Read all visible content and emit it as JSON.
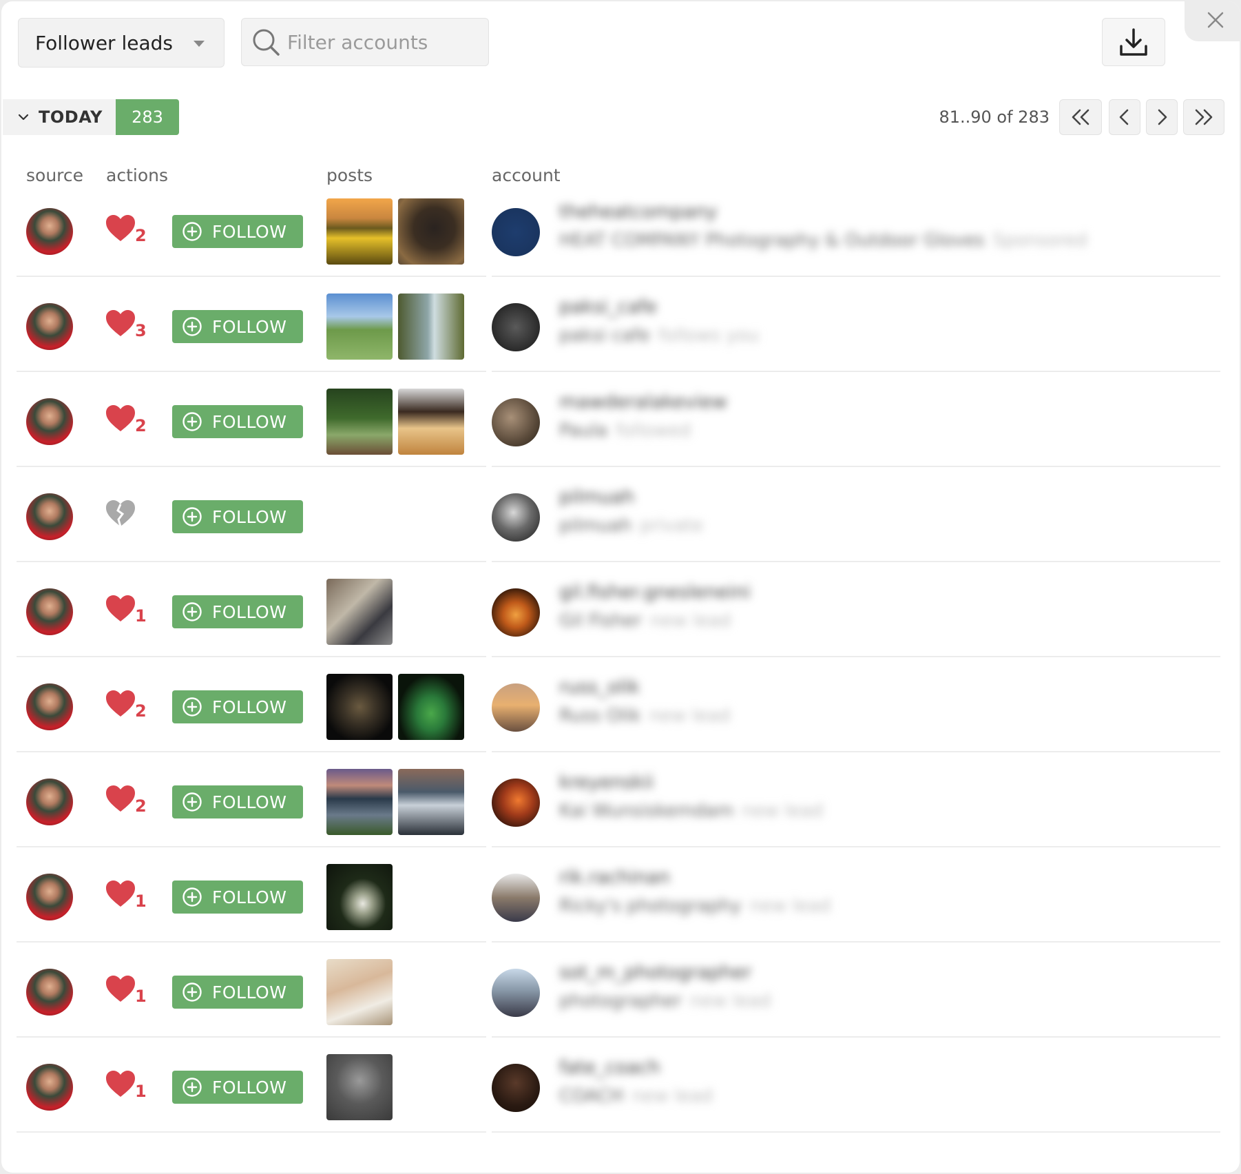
{
  "toolbar": {
    "list_selector": "Follower leads",
    "search_placeholder": "Filter accounts",
    "download_icon": "download-icon",
    "close_icon": "close-icon"
  },
  "section": {
    "label": "TODAY",
    "count": "283"
  },
  "pager": {
    "range_text": "81..90 of 283"
  },
  "columns": {
    "source": "source",
    "actions": "actions",
    "posts": "posts",
    "account": "account"
  },
  "follow_label": "FOLLOW",
  "colors": {
    "accent_green": "#6aad6a",
    "heart_red": "#d9434c",
    "heart_broken_gray": "#a9a9a9"
  },
  "rows": [
    {
      "likes": "2",
      "posts": [
        "sunflower-field",
        "gloved-hand"
      ],
      "username": "theheatcompany",
      "display_name": "HEAT COMPANY Photography & Outdoor Gloves",
      "extra": "Sponsored"
    },
    {
      "likes": "3",
      "posts": [
        "lakeside-dock",
        "forest-stream"
      ],
      "username": "paksi_cafe",
      "display_name": "paksi cafe",
      "extra": "follows you"
    },
    {
      "likes": "2",
      "posts": [
        "garden-plants",
        "coffee-and-toast"
      ],
      "username": "mawderalakeview",
      "display_name": "Paula",
      "extra": "followed"
    },
    {
      "likes": "",
      "posts": [],
      "username": "pilmuah",
      "display_name": "pilmuah",
      "extra": "private"
    },
    {
      "likes": "1",
      "posts": [
        "people-at-work"
      ],
      "username": "gil.fisher.gnesleneini",
      "display_name": "Gil Fisher",
      "extra": "new lead"
    },
    {
      "likes": "2",
      "posts": [
        "frog-closeup",
        "green-snake"
      ],
      "username": "russ_olik",
      "display_name": "Russ Olik",
      "extra": "new lead"
    },
    {
      "likes": "2",
      "posts": [
        "mountain-lake",
        "iceberg-lagoon"
      ],
      "username": "kreyenskii",
      "display_name": "Kai Wunsiskemdam",
      "extra": "new lead"
    },
    {
      "likes": "1",
      "posts": [
        "bride-in-forest"
      ],
      "username": "rik.rachinan",
      "display_name": "Ricky's photography",
      "extra": "new lead"
    },
    {
      "likes": "1",
      "posts": [
        "couple-portrait"
      ],
      "username": "sot_m_photographer",
      "display_name": "photographer",
      "extra": "new lead"
    },
    {
      "likes": "1",
      "posts": [
        "mono-portrait"
      ],
      "username": "fate_coach",
      "display_name": "COACH",
      "extra": "new lead"
    }
  ]
}
